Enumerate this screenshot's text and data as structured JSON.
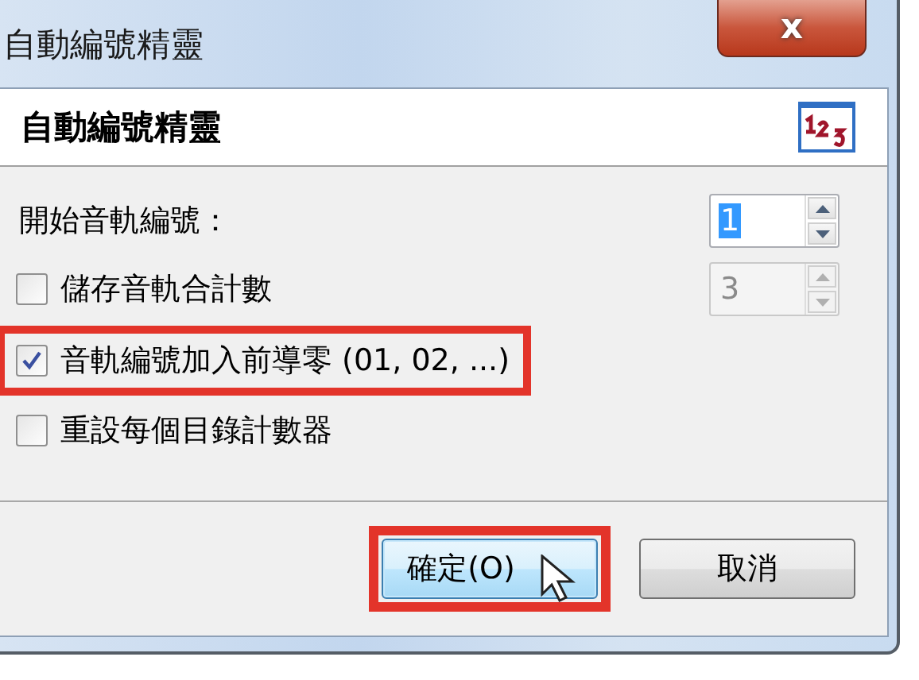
{
  "window": {
    "title": "自動編號精靈",
    "close_button": "x"
  },
  "header": {
    "title": "自動編號精靈"
  },
  "start_number": {
    "label": "開始音軌編號：",
    "value": "1",
    "focused": true,
    "disabled": false
  },
  "options": [
    {
      "kind": "checkbox_spin",
      "label": "儲存音軌合計數",
      "checked": false,
      "highlighted": false,
      "spin": {
        "value": "3",
        "disabled": true,
        "focused": false
      }
    },
    {
      "kind": "checkbox",
      "label": "音軌編號加入前導零 (01, 02, ...)",
      "checked": true,
      "highlighted": true
    },
    {
      "kind": "checkbox",
      "label": "重設每個目錄計數器",
      "checked": false,
      "highlighted": false
    }
  ],
  "buttons": [
    {
      "label": "確定(O)",
      "default": true,
      "highlighted": true,
      "hovered": true
    },
    {
      "label": "取消",
      "default": false,
      "highlighted": false,
      "hovered": false
    }
  ]
}
